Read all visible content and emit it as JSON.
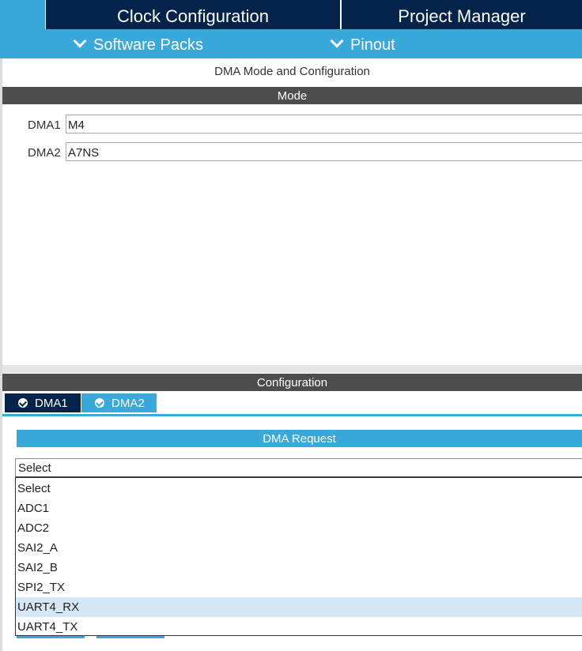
{
  "top_tabs": {
    "clock": "Clock Configuration",
    "project": "Project Manager"
  },
  "sub_nav": {
    "software_packs": "Software Packs",
    "pinout": "Pinout"
  },
  "panel_title": "DMA Mode and Configuration",
  "mode": {
    "header": "Mode",
    "fields": [
      {
        "label": "DMA1",
        "value": "M4"
      },
      {
        "label": "DMA2",
        "value": "A7NS"
      }
    ]
  },
  "configuration": {
    "header": "Configuration",
    "tabs": [
      {
        "label": "DMA1"
      },
      {
        "label": "DMA2"
      }
    ],
    "request_header": "DMA Request",
    "select_value": "Select",
    "options": [
      "Select",
      "ADC1",
      "ADC2",
      "SAI2_A",
      "SAI2_B",
      "SPI2_TX",
      "UART4_RX",
      "UART4_TX"
    ],
    "highlighted_option": "UART4_RX"
  },
  "colors": {
    "navy": "#03234b",
    "accent": "#39a9dc",
    "dark_bar": "#4d4d4d",
    "highlight": "#d6e8f5"
  },
  "icons": {
    "chevron": "chevron-down-icon",
    "check": "check-circle-icon"
  }
}
